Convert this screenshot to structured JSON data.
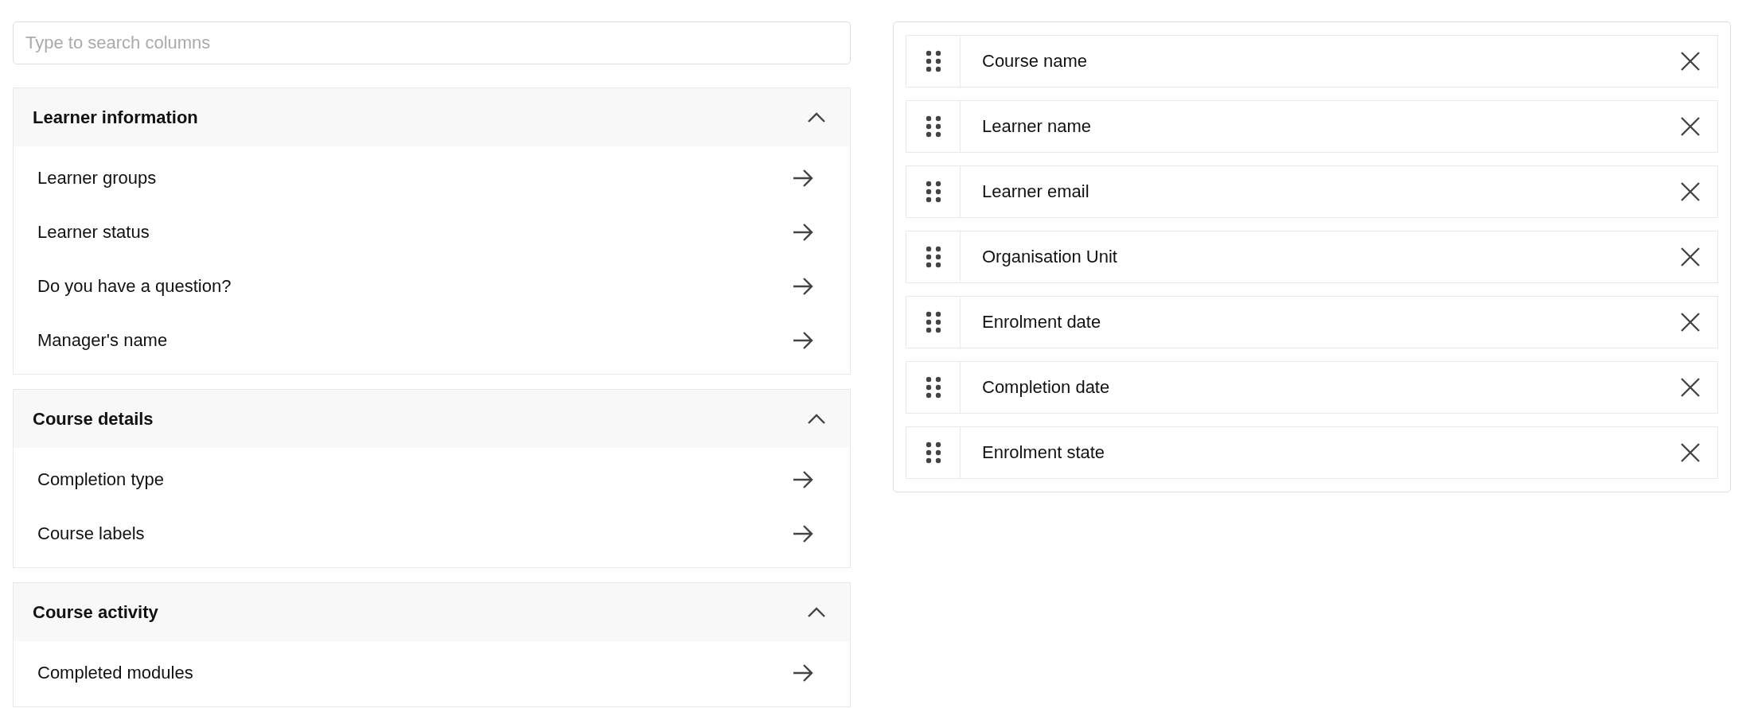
{
  "search": {
    "placeholder": "Type to search columns"
  },
  "sections": [
    {
      "title": "Learner information",
      "expanded": true,
      "items": [
        "Learner groups",
        "Learner status",
        "Do you have a question?",
        "Manager's name"
      ]
    },
    {
      "title": "Course details",
      "expanded": true,
      "items": [
        "Completion type",
        "Course labels"
      ]
    },
    {
      "title": "Course activity",
      "expanded": true,
      "items": [
        "Completed modules"
      ]
    }
  ],
  "selected_columns": [
    "Course name",
    "Learner name",
    "Learner email",
    "Organisation Unit",
    "Enrolment date",
    "Completion date",
    "Enrolment state"
  ]
}
